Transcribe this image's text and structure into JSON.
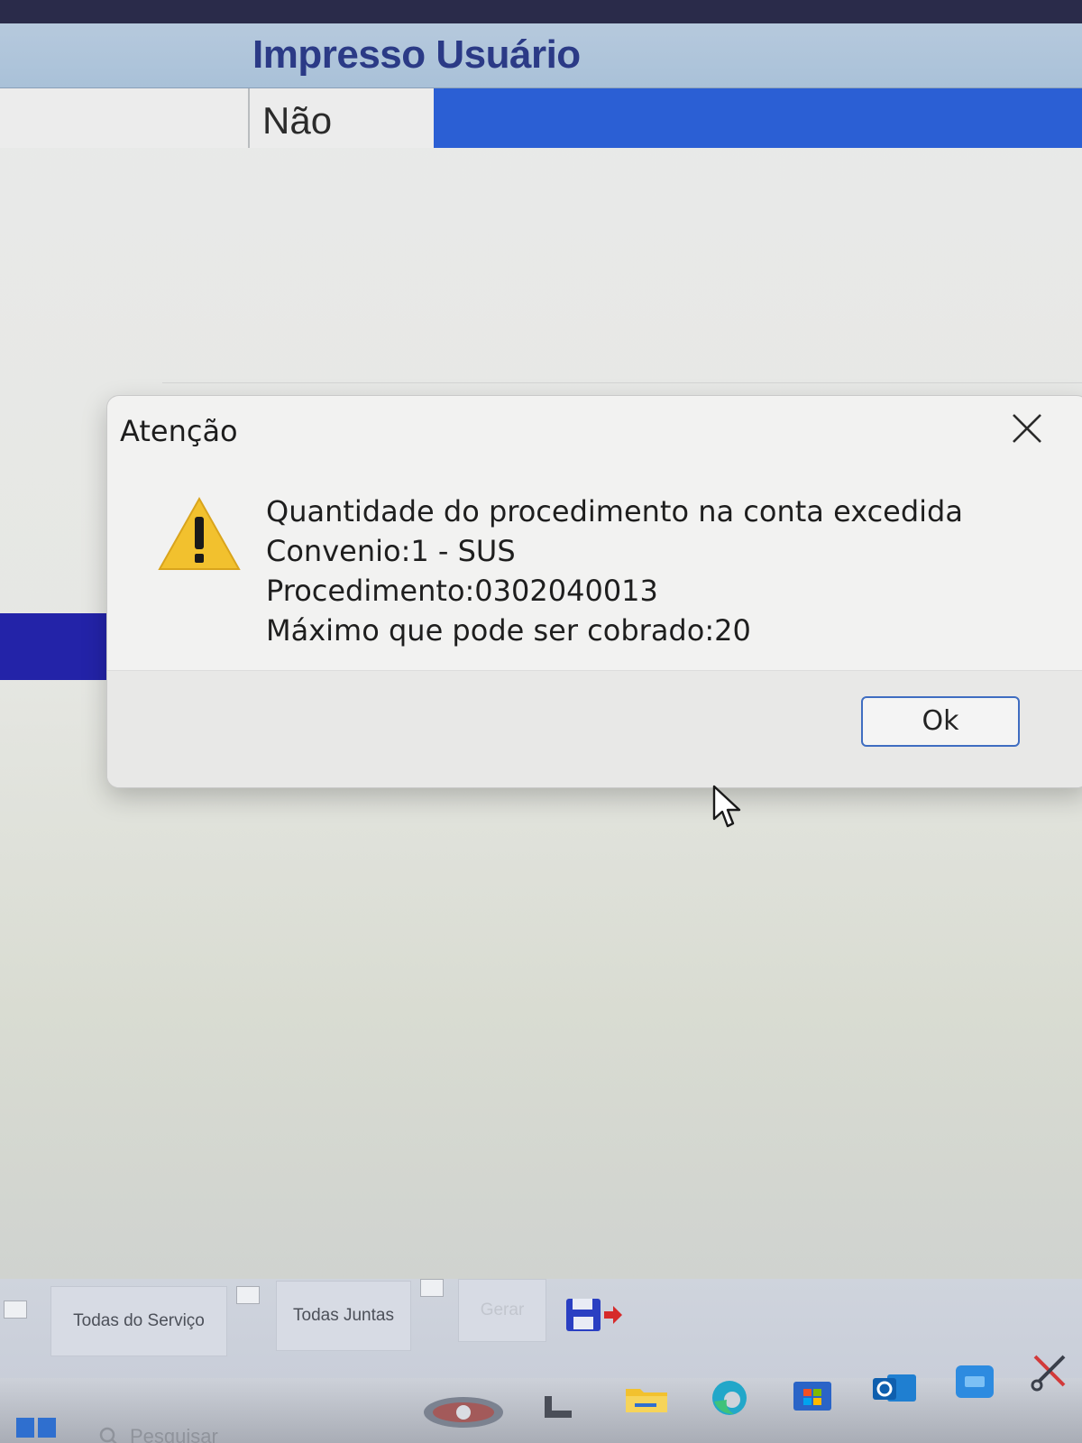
{
  "grid": {
    "column_header": "Impresso Usuário",
    "row_value": "Não"
  },
  "dialog": {
    "title": "Atenção",
    "message_lines": [
      "Quantidade do procedimento na conta excedida",
      "Convenio:1 - SUS",
      "Procedimento:0302040013",
      "Máximo que pode ser cobrado:20"
    ],
    "ok_label": "Ok",
    "warning_icon": "warning-triangle-icon",
    "close_icon": "close-icon"
  },
  "toolbar": {
    "todas_servico_label": "Todas do Serviço",
    "todas_juntas_label": "Todas Juntas",
    "disabled_button_label": "Gerar",
    "save_icon": "save-disk-icon"
  },
  "taskbar": {
    "search_placeholder": "Pesquisar"
  },
  "colors": {
    "header_text": "#2b3a86",
    "selection_blue": "#2b5fd4",
    "band_blue": "#2323a8",
    "warning_yellow": "#f2c12e",
    "ok_border": "#3f6dc1"
  }
}
